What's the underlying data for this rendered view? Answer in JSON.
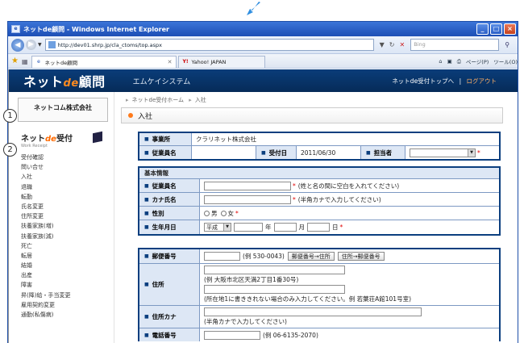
{
  "browser": {
    "title": "ネットde顧問 - Windows Internet Explorer",
    "url": "http://dev01.shrp.jp/cla_ctoms/top.aspx",
    "search_placeholder": "Bing",
    "tabs": [
      {
        "label": "ネットde顧問"
      },
      {
        "label": "Yahoo! JAPAN"
      }
    ],
    "tools": {
      "page": "ページ(P)",
      "tools": "ツール(O)"
    }
  },
  "header": {
    "logo_main": "ネット",
    "logo_de": "de",
    "logo_tail": "顧問",
    "company": "エムケイシステム",
    "link_top": "ネットde受付トップへ",
    "link_sep": "|",
    "link_logout": "ログアウト"
  },
  "sidebar": {
    "company": "ネットコム株式会社",
    "title_a": "ネット",
    "title_de": "de",
    "title_b": "受付",
    "subtitle": "Work Receipt",
    "items": [
      "受付確認",
      "問い合せ",
      "入社",
      "退職",
      "転勤",
      "氏名変更",
      "住所変更",
      "扶養家族(増)",
      "扶養家族(減)",
      "死亡",
      "転居",
      "結婚",
      "出産",
      "障害",
      "昇(降)給・手当変更",
      "雇用契約変更",
      "通勤(私傷病)"
    ]
  },
  "markers": {
    "m1": "1",
    "m2": "2"
  },
  "breadcrumb": {
    "home": "ネットde受付ホーム",
    "current": "入社"
  },
  "page_title": "入社",
  "top_form": {
    "office_label": "事業所",
    "office_value": "クラリネット株式会社",
    "emp_label": "従業員名",
    "recv_label": "受付日",
    "recv_value": "2011/06/30",
    "staff_label": "担当者"
  },
  "basic": {
    "section": "基本情報",
    "name_label": "従業員名",
    "name_note": "(姓と名の間に空白を入れてください)",
    "kana_label": "カナ氏名",
    "kana_note": "(半角カナで入力してください)",
    "sex_label": "性別",
    "sex_male": "男",
    "sex_female": "女",
    "birth_label": "生年月日",
    "birth_era": "平成",
    "year": "年",
    "month": "月",
    "day": "日"
  },
  "address": {
    "zip_label": "郵便番号",
    "zip_example": "(例 530-0043)",
    "btn_zip_to_addr": "郵便番号→住所",
    "btn_addr_to_zip": "住所→郵便番号",
    "addr_label": "住所",
    "addr_example": "(例 大阪市北区天満2丁目1番30号)",
    "addr_note": "(所在地1に書ききれない場合のみ入力してください。例 若葉荘A館101号室)",
    "kana_label": "住所カナ",
    "kana_note": "(半角カナで入力してください)",
    "tel_label": "電話番号",
    "tel_example": "(例 06-6135-2070)"
  },
  "required_mark": "*",
  "colors": {
    "header": "#0a3d7a",
    "accent": "#ff7a1a",
    "label_bg": "#dde7f5",
    "border": "#0b3f7f"
  }
}
